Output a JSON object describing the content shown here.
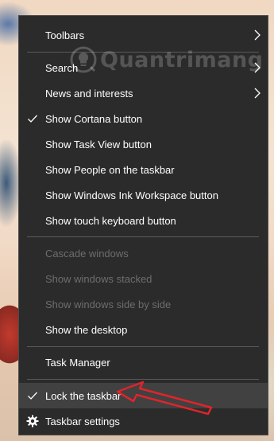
{
  "watermark": {
    "text": "Quantrimang"
  },
  "menu": {
    "toolbars": "Toolbars",
    "search": "Search",
    "news": "News and interests",
    "cortana": "Show Cortana button",
    "task_view": "Show Task View button",
    "people": "Show People on the taskbar",
    "ink": "Show Windows Ink Workspace button",
    "touch_kb": "Show touch keyboard button",
    "cascade": "Cascade windows",
    "stacked": "Show windows stacked",
    "side_by_side": "Show windows side by side",
    "desktop": "Show the desktop",
    "task_manager": "Task Manager",
    "lock": "Lock the taskbar",
    "settings": "Taskbar settings"
  },
  "colors": {
    "menu_bg": "#2b2b2b",
    "highlight": "#414141",
    "disabled_text": "#6d6d6d",
    "annotation_arrow": "#e0242b"
  }
}
